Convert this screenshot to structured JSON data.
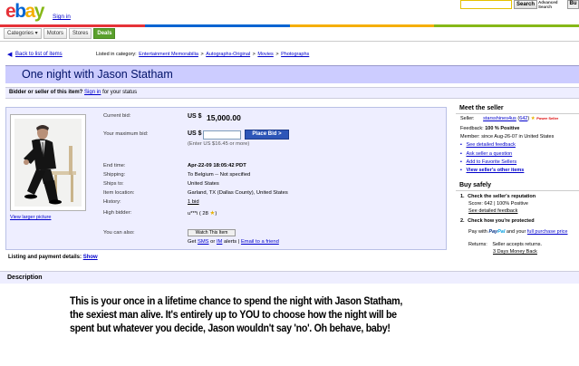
{
  "header": {
    "logo_letters": [
      {
        "ch": "e",
        "color": "#e53238"
      },
      {
        "ch": "b",
        "color": "#0064d2"
      },
      {
        "ch": "a",
        "color": "#f5af02"
      },
      {
        "ch": "y",
        "color": "#86b817"
      }
    ],
    "sign_in": "Sign in",
    "search_placeholder": "",
    "search_button": "Search",
    "advanced_search": "Advanced Search",
    "cut_button": "Bu",
    "colorbar": [
      "#e53238",
      "#0064d2",
      "#f5af02",
      "#86b817"
    ]
  },
  "nav": {
    "items": [
      "Categories ▾",
      "Motors",
      "Stores",
      "Deals"
    ]
  },
  "breadcrumb": {
    "back": "Back to list of items",
    "listed_in": "Listed in category:",
    "path": [
      "Entertainment Memorabilia",
      "Autographs-Original",
      "Movies",
      "Photographs"
    ],
    "sep": ">"
  },
  "listing": {
    "title": "One night with Jason Statham",
    "bidder_prompt": "Bidder or seller of this item?",
    "sign_in": "Sign in",
    "bidder_suffix": "for your status",
    "view_larger": "View larger picture",
    "current_bid_label": "Current bid:",
    "current_bid_currency": "US $",
    "current_bid_value": "15,000.00",
    "max_bid_label": "Your maximum bid:",
    "max_bid_currency": "US $",
    "max_bid_value": "",
    "place_bid": "Place Bid >",
    "max_bid_hint": "(Enter US $16.45 or more)",
    "rows": [
      {
        "label": "End time:",
        "value": "Apr-22-09 18:05:42 PDT"
      },
      {
        "label": "Shipping:",
        "value": "To Belgium -- Not specified"
      },
      {
        "label": "Ships to:",
        "value": "United States"
      },
      {
        "label": "Item location:",
        "value": "Garland, TX (Dallas County), United States"
      },
      {
        "label": "History:",
        "value": "1 bid"
      },
      {
        "label": "High bidder:",
        "value": "u***i ( 28"
      }
    ],
    "high_bidder_close": ")",
    "also_label": "You can also:",
    "watch": "Watch This Item",
    "get": "Get",
    "sms": "SMS",
    "or": "or",
    "im": "IM",
    "alerts": "alerts |",
    "email": "Email to a friend",
    "listing_payment": "Listing and payment details:",
    "show": "Show"
  },
  "description": {
    "heading": "Description",
    "lines": [
      "This is your once in a lifetime chance to spend the night with Jason Statham,",
      "the sexiest man alive. It's entirely up to YOU to choose how the night will be",
      "spent but whatever you decide, Jason wouldn't say 'no'. Oh behave, baby!"
    ]
  },
  "seller": {
    "heading": "Meet the seller",
    "seller_label": "Seller:",
    "seller_name": "starsshines4us",
    "seller_score_open": "(",
    "seller_score": "642",
    "seller_score_close": ")",
    "power_seller": "Power Seller",
    "feedback_label": "Feedback:",
    "feedback_value": "100 % Positive",
    "member_label": "Member:",
    "member_value": "since Aug-26-07 in United States",
    "links": [
      "See detailed feedback",
      "Ask seller a question",
      "Add to Favorite Sellers",
      "View seller's other items"
    ]
  },
  "safety": {
    "heading": "Buy safely",
    "step1_num": "1.",
    "step1": "Check the seller's reputation",
    "step1_score": "Score: 642 | 100% Positive",
    "step1_link": "See detailed feedback",
    "step2_num": "2.",
    "step2": "Check how you're protected",
    "pay_with": "Pay with",
    "paypal_a": "Pay",
    "paypal_b": "Pal",
    "pay_and": "and your",
    "pay_link": "full purchase price",
    "returns_label": "Returns:",
    "returns_value": "Seller accepts returns.",
    "returns_link": "3 Days Money Back"
  }
}
